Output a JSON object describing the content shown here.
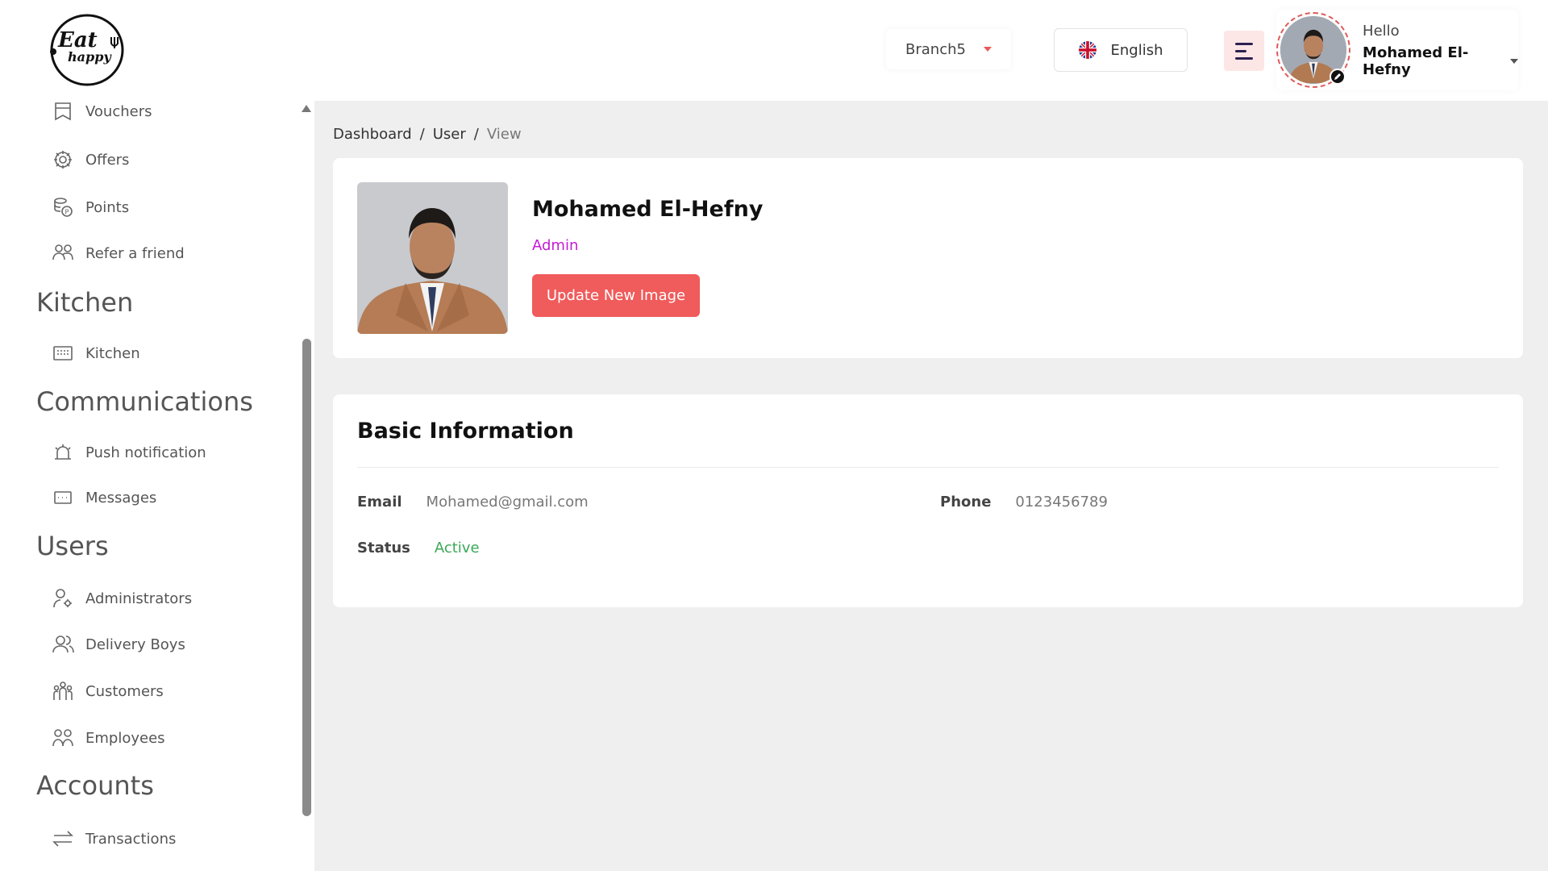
{
  "header": {
    "branch": "Branch5",
    "language": "English",
    "greeting": "Hello",
    "user_name": "Mohamed El-Hefny"
  },
  "sidebar": {
    "logo_text": [
      "Eat",
      "happy"
    ],
    "items": [
      {
        "label": "Vouchers",
        "icon": "voucher-icon"
      },
      {
        "label": "Offers",
        "icon": "gear-icon"
      },
      {
        "label": "Points",
        "icon": "coins-icon"
      },
      {
        "label": "Refer a friend",
        "icon": "refer-icon"
      },
      {
        "label": "Kitchen",
        "icon": "kitchen-icon"
      },
      {
        "label": "Push notification",
        "icon": "bell-icon"
      },
      {
        "label": "Messages",
        "icon": "message-icon"
      },
      {
        "label": "Administrators",
        "icon": "admin-icon"
      },
      {
        "label": "Delivery Boys",
        "icon": "users-icon"
      },
      {
        "label": "Customers",
        "icon": "customers-icon"
      },
      {
        "label": "Employees",
        "icon": "employees-icon"
      },
      {
        "label": "Transactions",
        "icon": "transfer-icon"
      }
    ],
    "sections": [
      "Kitchen",
      "Communications",
      "Users",
      "Accounts"
    ]
  },
  "breadcrumb": {
    "items": [
      "Dashboard",
      "User",
      "View"
    ],
    "separator": "/"
  },
  "profile": {
    "name": "Mohamed El-Hefny",
    "role": "Admin",
    "update_button": "Update New Image"
  },
  "basic_info": {
    "title": "Basic Information",
    "email_label": "Email",
    "email": "Mohamed@gmail.com",
    "phone_label": "Phone",
    "phone": "0123456789",
    "status_label": "Status",
    "status": "Active"
  },
  "colors": {
    "accent": "#f05b5b",
    "role": "#c41bd6",
    "status_active": "#3aa856"
  }
}
